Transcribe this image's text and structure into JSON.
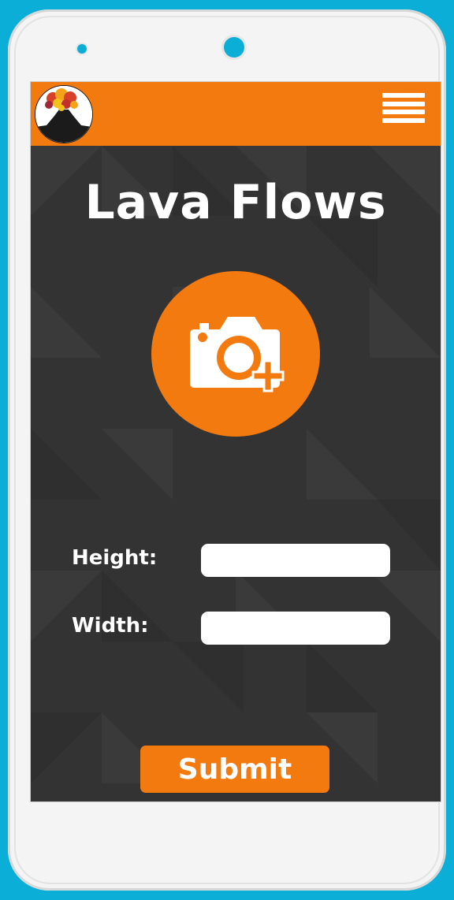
{
  "app": {
    "title": "Lava Flows",
    "logo_icon": "volcano-icon",
    "menu_icon": "hamburger-menu-icon"
  },
  "main": {
    "photo_button_icon": "camera-add-icon",
    "fields": [
      {
        "label": "Height:",
        "value": "",
        "placeholder": ""
      },
      {
        "label": "Width:",
        "value": "",
        "placeholder": ""
      }
    ],
    "submit_label": "Submit"
  },
  "colors": {
    "accent": "#f37a0f",
    "screen_background": "#333333",
    "device_background": "#0aaed6",
    "text": "#ffffff"
  }
}
